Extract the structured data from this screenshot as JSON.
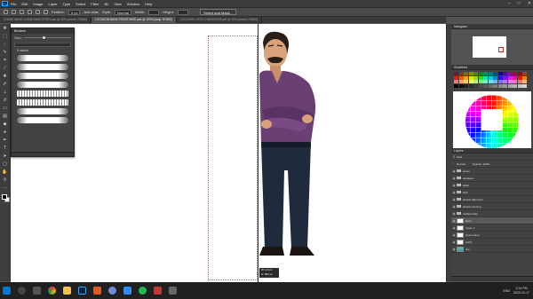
{
  "menu": [
    "File",
    "Edit",
    "Image",
    "Layer",
    "Type",
    "Select",
    "Filter",
    "3D",
    "View",
    "Window",
    "Help"
  ],
  "options": {
    "feather_label": "Feather:",
    "feather_value": "0 px",
    "antialias_label": "Anti-alias",
    "style_label": "Style:",
    "style_value": "Normal",
    "width_label": "Width:",
    "height_label": "Height:",
    "select_mask": "Select and Mask..."
  },
  "tabs": [
    {
      "label": "CHASE ANGIE LEANE MAIN STORY.psd @ 33% (cerveil, RGB/8)"
    },
    {
      "label": "LOCATION BANK FRONTYARD.psd @ 100% (lamp, RGB/8)",
      "active": true
    },
    {
      "label": "LOCATION VISTA G BEDROOM.psd @ 33% (cerveil, RGB/8)"
    }
  ],
  "brushes": {
    "title": "Brushes",
    "size_label": "Size:",
    "group_label": "ll valise"
  },
  "info_box": {
    "line1": "W: 2.8 px",
    "line2": "H: 581 px"
  },
  "panels": {
    "navigator": "Navigator",
    "swatches": "Swatches",
    "color": "Color",
    "layers": "Layers",
    "kind_label": "Kind",
    "blend_mode": "Normal",
    "opacity_label": "Opacity: 100%"
  },
  "layers": [
    {
      "name": "scene",
      "type": "folder"
    },
    {
      "name": "shadows",
      "type": "folder"
    },
    {
      "name": "lights",
      "type": "folder"
    },
    {
      "name": "DAY",
      "type": "folder"
    },
    {
      "name": "shared afternoon",
      "type": "folder"
    },
    {
      "name": "shared evening",
      "type": "folder"
    },
    {
      "name": "tooltips body",
      "type": "folder"
    },
    {
      "name": "lamp",
      "type": "layer",
      "selected": true
    },
    {
      "name": "Layer 1",
      "type": "layer"
    },
    {
      "name": "clear button",
      "type": "layer"
    },
    {
      "name": "paths",
      "type": "layer"
    },
    {
      "name": "sky",
      "type": "sky"
    }
  ],
  "tray": {
    "lang": "ENG",
    "time": "2:14 PM",
    "date": "2020-10-17"
  },
  "colors": {
    "pink_guide": "#9a6a8a",
    "selection_red": "#e02020"
  }
}
